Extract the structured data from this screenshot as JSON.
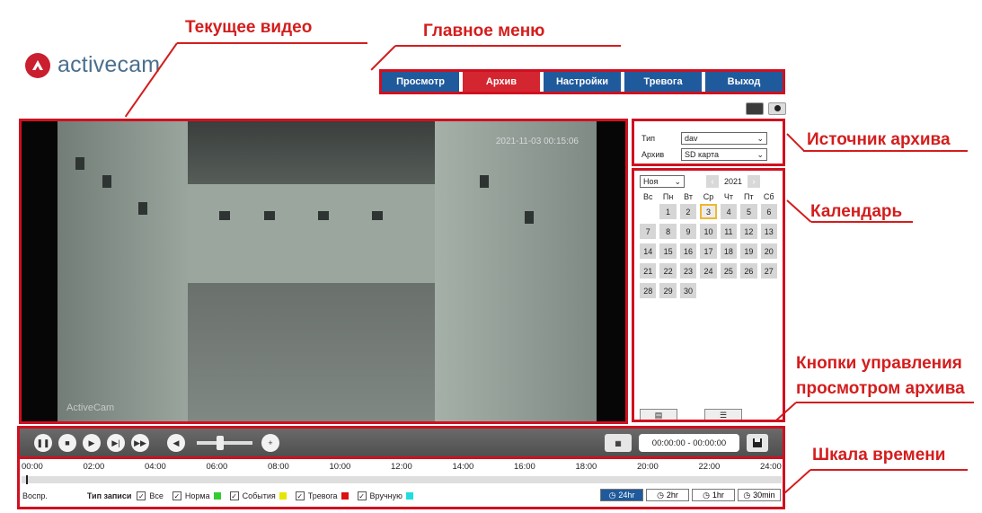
{
  "logo": {
    "text": "activecam"
  },
  "menu": {
    "items": [
      "Просмотр",
      "Архив",
      "Настройки",
      "Тревога",
      "Выход"
    ],
    "active": "Архив"
  },
  "callouts": {
    "video": "Текущее видео",
    "menu": "Главное меню",
    "source": "Источник архива",
    "calendar": "Календарь",
    "controls_1": "Кнопки управления",
    "controls_2": "просмотром архива",
    "timeline": "Шкала времени"
  },
  "video": {
    "timestamp": "2021-11-03 00:15:06",
    "watermark": "ActiveCam"
  },
  "source": {
    "type_label": "Тип",
    "type_value": "dav",
    "archive_label": "Архив",
    "archive_value": "SD карта"
  },
  "calendar": {
    "month": "Ноя",
    "year": "2021",
    "weekdays": [
      "Вс",
      "Пн",
      "Вт",
      "Ср",
      "Чт",
      "Пт",
      "Сб"
    ],
    "selected_day": "3",
    "weeks": [
      [
        "",
        "1",
        "2",
        "3",
        "4",
        "5",
        "6"
      ],
      [
        "7",
        "8",
        "9",
        "10",
        "11",
        "12",
        "13"
      ],
      [
        "14",
        "15",
        "16",
        "17",
        "18",
        "19",
        "20"
      ],
      [
        "21",
        "22",
        "23",
        "24",
        "25",
        "26",
        "27"
      ],
      [
        "28",
        "29",
        "30",
        "",
        "",
        "",
        ""
      ]
    ]
  },
  "controls": {
    "time_range": "00:00:00 - 00:00:00"
  },
  "timeline": {
    "ticks": [
      "00:00",
      "02:00",
      "04:00",
      "06:00",
      "08:00",
      "10:00",
      "12:00",
      "14:00",
      "16:00",
      "18:00",
      "20:00",
      "22:00",
      "24:00"
    ],
    "play_label": "Воспр.",
    "record_type_label": "Тип записи",
    "filters": [
      {
        "label": "Все",
        "color": ""
      },
      {
        "label": "Норма",
        "color": "#33cc33"
      },
      {
        "label": "События",
        "color": "#e6e600"
      },
      {
        "label": "Тревога",
        "color": "#dd1111"
      },
      {
        "label": "Вручную",
        "color": "#22dddd"
      }
    ],
    "zoom": [
      "24hr",
      "2hr",
      "1hr",
      "30min"
    ],
    "zoom_active": "24hr"
  },
  "colors": {
    "accent_red": "#d01020",
    "menu_blue": "#1f5a9c",
    "active_tab": "#d42630"
  }
}
